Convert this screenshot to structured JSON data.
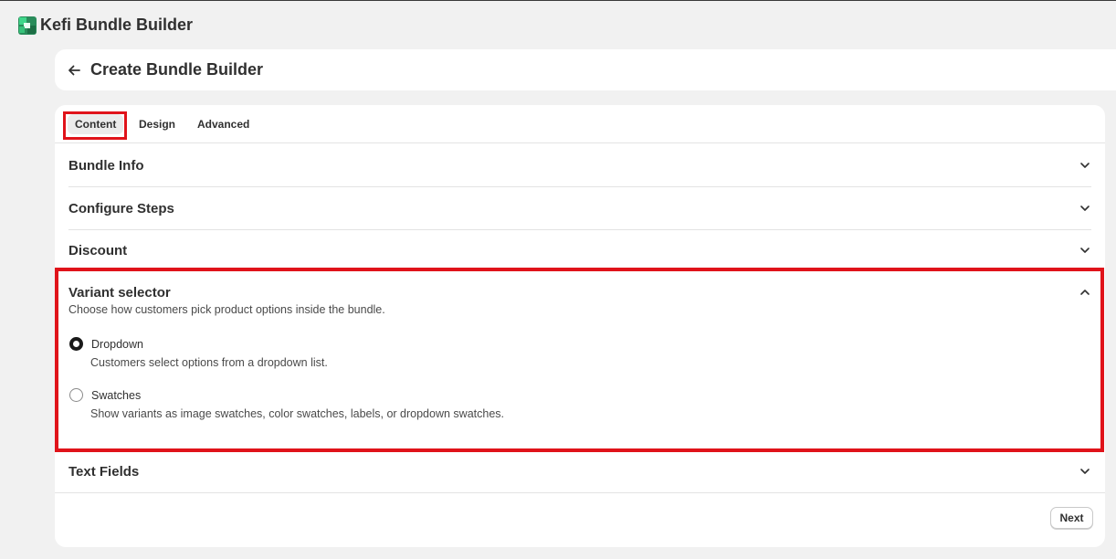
{
  "app": {
    "title": "Kefi Bundle Builder",
    "logo_icon": "kefi-logo-icon"
  },
  "page": {
    "title": "Create Bundle Builder",
    "back_icon": "back-arrow-icon"
  },
  "tabs": [
    {
      "label": "Content",
      "active": true
    },
    {
      "label": "Design",
      "active": false
    },
    {
      "label": "Advanced",
      "active": false
    }
  ],
  "sections": {
    "bundle_info": {
      "title": "Bundle Info",
      "expanded": false
    },
    "configure_steps": {
      "title": "Configure Steps",
      "expanded": false
    },
    "discount": {
      "title": "Discount",
      "expanded": false
    },
    "variant_selector": {
      "title": "Variant selector",
      "expanded": true,
      "description": "Choose how customers pick product options inside the bundle.",
      "selected": "Dropdown",
      "options": [
        {
          "label": "Dropdown",
          "help": "Customers select options from a dropdown list.",
          "checked": true
        },
        {
          "label": "Swatches",
          "help": "Show variants as image swatches, color swatches, labels, or dropdown swatches.",
          "checked": false
        }
      ]
    },
    "text_fields": {
      "title": "Text Fields",
      "expanded": false
    }
  },
  "footer": {
    "next_label": "Next"
  },
  "colors": {
    "highlight": "#e0131a",
    "background": "#f1f1f1",
    "card": "#ffffff",
    "text": "#303030",
    "logo_green": "#1fb56b"
  }
}
